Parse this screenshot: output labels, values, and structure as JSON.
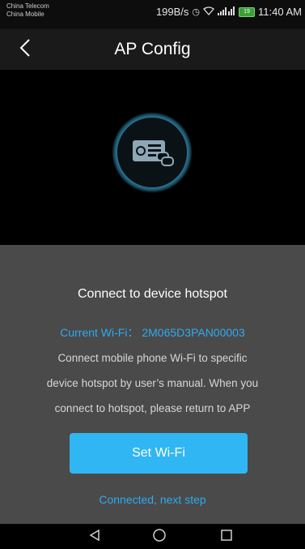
{
  "status_bar": {
    "carrier_1": "China Telecom",
    "carrier_2": "China Mobile",
    "net_speed": "199B/s",
    "battery": "19",
    "time": "11:40 AM"
  },
  "header": {
    "back_icon": "chevron-left-icon",
    "title": "AP Config"
  },
  "hero": {
    "icon": "ap-device-icon"
  },
  "panel": {
    "heading": "Connect to device hotspot",
    "current_wifi_label": "Current Wi-Fi：",
    "current_wifi_value": "2M065D3PAN00003",
    "desc_line_1": "Connect mobile phone Wi-Fi to specific",
    "desc_line_2": "device hotspot by user’s manual. When you",
    "desc_line_3": "connect to hotspot, please return to APP",
    "set_wifi_label": "Set Wi-Fi",
    "next_label": "Connected, next step"
  },
  "nav_bar": {
    "back": "triangle-back-icon",
    "home": "circle-home-icon",
    "recents": "square-recents-icon"
  },
  "colors": {
    "accent": "#30b6f2",
    "panel_bg": "#4a4a4a",
    "header_bg": "#1a1a1a"
  }
}
